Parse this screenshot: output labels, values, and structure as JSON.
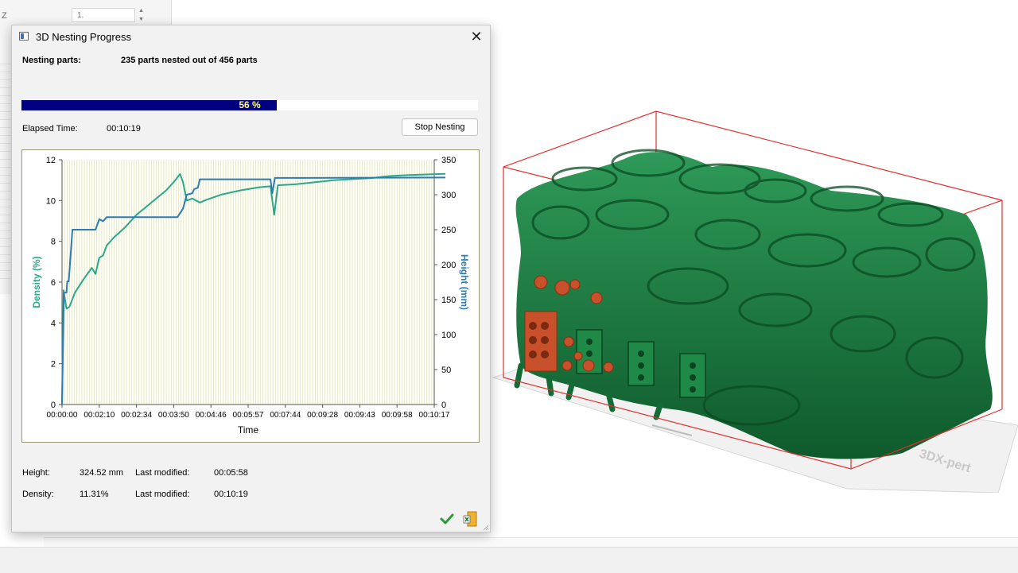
{
  "dialog": {
    "title": "3D Nesting Progress",
    "nesting_label": "Nesting parts:",
    "nesting_value": "235 parts nested out of 456 parts",
    "progress_percent": 56,
    "progress_text": "56 %",
    "elapsed_label": "Elapsed Time:",
    "elapsed_value": "00:10:19",
    "stop_button": "Stop Nesting",
    "height_label": "Height:",
    "height_value": "324.52 mm",
    "height_modified_label": "Last modified:",
    "height_modified_value": "00:05:58",
    "density_label": "Density:",
    "density_value": "11.31%",
    "density_modified_label": "Last modified:",
    "density_modified_value": "00:10:19"
  },
  "background": {
    "field_value": "1.",
    "axis_letter": "Z"
  },
  "viewport": {
    "plate_text": "3DX-pert",
    "part_color": "#1b7a3e",
    "highlight_color": "#c8502a",
    "box_color": "#e03030"
  },
  "chart_data": {
    "type": "line",
    "xlabel": "Time",
    "ylabel_left": "Density (%)",
    "ylabel_right": "Height (mm)",
    "x_ticks": [
      "00:00:00",
      "00:02:10",
      "00:02:34",
      "00:03:50",
      "00:04:46",
      "00:05:57",
      "00:07:44",
      "00:09:28",
      "00:09:43",
      "00:09:58",
      "00:10:17"
    ],
    "ylim_left": [
      0,
      12
    ],
    "yticks_left": [
      0,
      2,
      4,
      6,
      8,
      10,
      12
    ],
    "ylim_right": [
      0,
      350
    ],
    "yticks_right": [
      0,
      50,
      100,
      150,
      200,
      250,
      300,
      350
    ],
    "grid": true,
    "series": [
      {
        "name": "Density (%)",
        "axis": "left",
        "color": "#2aa889",
        "points": [
          [
            0,
            0
          ],
          [
            0.04,
            5.6
          ],
          [
            0.12,
            4.7
          ],
          [
            0.2,
            4.8
          ],
          [
            0.35,
            5.5
          ],
          [
            0.6,
            6.2
          ],
          [
            0.8,
            6.7
          ],
          [
            0.9,
            6.4
          ],
          [
            1.0,
            7.2
          ],
          [
            1.1,
            7.3
          ],
          [
            1.2,
            7.8
          ],
          [
            1.4,
            8.2
          ],
          [
            1.7,
            8.7
          ],
          [
            2.0,
            9.3
          ],
          [
            2.4,
            9.9
          ],
          [
            2.8,
            10.5
          ],
          [
            3.0,
            10.9
          ],
          [
            3.17,
            11.3
          ],
          [
            3.25,
            10.9
          ],
          [
            3.35,
            10.0
          ],
          [
            3.5,
            10.1
          ],
          [
            3.7,
            9.9
          ],
          [
            3.9,
            10.05
          ],
          [
            4.3,
            10.3
          ],
          [
            4.8,
            10.5
          ],
          [
            5.3,
            10.65
          ],
          [
            5.6,
            10.7
          ],
          [
            5.7,
            9.3
          ],
          [
            5.8,
            10.75
          ],
          [
            6.3,
            10.8
          ],
          [
            6.8,
            10.9
          ],
          [
            7.3,
            11.0
          ],
          [
            7.8,
            11.05
          ],
          [
            8.3,
            11.1
          ],
          [
            8.8,
            11.2
          ],
          [
            9.3,
            11.25
          ],
          [
            9.8,
            11.28
          ],
          [
            10.1,
            11.3
          ],
          [
            10.3,
            11.31
          ]
        ]
      },
      {
        "name": "Height (mm)",
        "axis": "right",
        "color": "#2b7bb5",
        "points": [
          [
            0,
            0
          ],
          [
            0.05,
            160
          ],
          [
            0.12,
            160
          ],
          [
            0.14,
            176
          ],
          [
            0.18,
            176
          ],
          [
            0.28,
            250
          ],
          [
            0.9,
            250
          ],
          [
            1.0,
            265
          ],
          [
            1.1,
            262
          ],
          [
            1.2,
            268
          ],
          [
            3.1,
            268
          ],
          [
            3.25,
            280
          ],
          [
            3.35,
            300
          ],
          [
            3.5,
            302
          ],
          [
            3.55,
            308
          ],
          [
            3.65,
            310
          ],
          [
            3.7,
            322
          ],
          [
            5.6,
            322
          ],
          [
            5.65,
            302
          ],
          [
            5.72,
            324
          ],
          [
            10.3,
            324.52
          ]
        ]
      }
    ]
  }
}
